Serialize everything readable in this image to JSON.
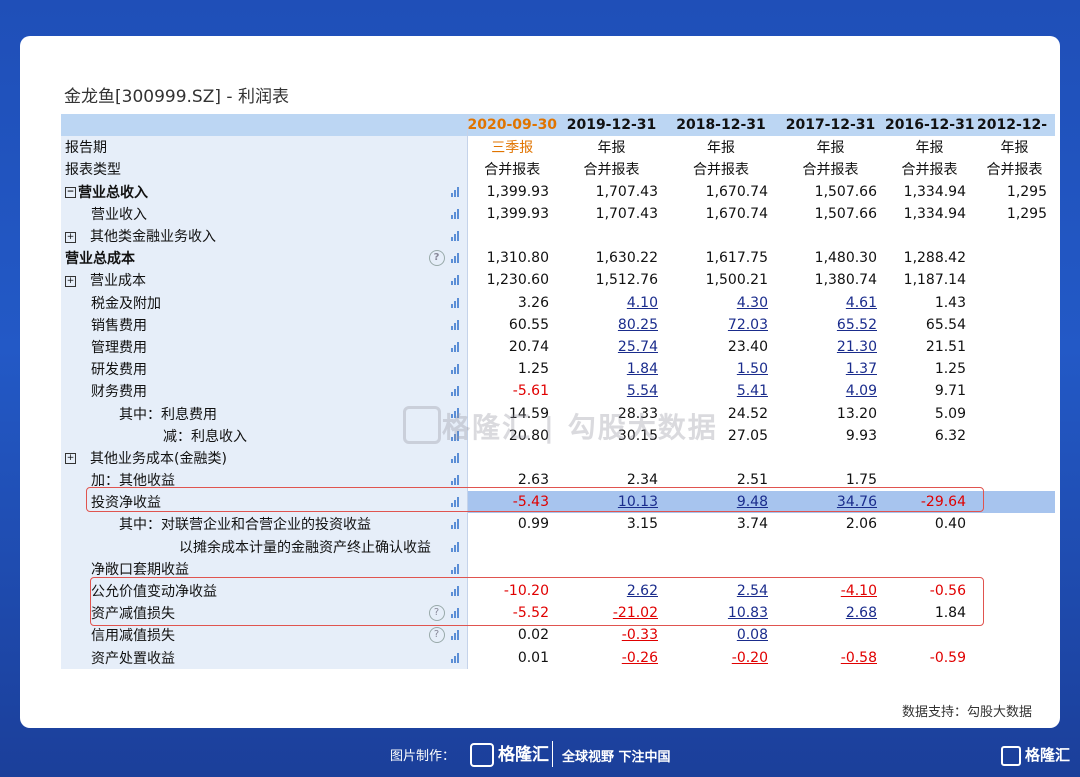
{
  "title": "金龙鱼[300999.SZ] - 利润表",
  "columns": [
    "2020-09-30",
    "2019-12-31",
    "2018-12-31",
    "2017-12-31",
    "2016-12-31",
    "2012-12-"
  ],
  "report_period": {
    "label": "报告期",
    "values": [
      "三季报",
      "年报",
      "年报",
      "年报",
      "年报",
      "年报"
    ]
  },
  "report_type": {
    "label": "报表类型",
    "values": [
      "合并报表",
      "合并报表",
      "合并报表",
      "合并报表",
      "合并报表",
      "合并报表"
    ]
  },
  "rows": [
    {
      "label": "营业总收入",
      "values": [
        "1,399.93",
        "1,707.43",
        "1,670.74",
        "1,507.66",
        "1,334.94",
        "1,295"
      ]
    },
    {
      "label": "营业收入",
      "values": [
        "1,399.93",
        "1,707.43",
        "1,670.74",
        "1,507.66",
        "1,334.94",
        "1,295"
      ]
    },
    {
      "label": "其他类金融业务收入",
      "values": [
        "",
        "",
        "",
        "",
        "",
        ""
      ]
    },
    {
      "label": "营业总成本",
      "values": [
        "1,310.80",
        "1,630.22",
        "1,617.75",
        "1,480.30",
        "1,288.42",
        ""
      ]
    },
    {
      "label": "营业成本",
      "values": [
        "1,230.60",
        "1,512.76",
        "1,500.21",
        "1,380.74",
        "1,187.14",
        ""
      ]
    },
    {
      "label": "税金及附加",
      "values": [
        "3.26",
        "4.10",
        "4.30",
        "4.61",
        "1.43",
        ""
      ]
    },
    {
      "label": "销售费用",
      "values": [
        "60.55",
        "80.25",
        "72.03",
        "65.52",
        "65.54",
        ""
      ]
    },
    {
      "label": "管理费用",
      "values": [
        "20.74",
        "25.74",
        "23.40",
        "21.30",
        "21.51",
        ""
      ]
    },
    {
      "label": "研发费用",
      "values": [
        "1.25",
        "1.84",
        "1.50",
        "1.37",
        "1.25",
        ""
      ]
    },
    {
      "label": "财务费用",
      "values": [
        "-5.61",
        "5.54",
        "5.41",
        "4.09",
        "9.71",
        ""
      ]
    },
    {
      "label": "其中：利息费用",
      "values": [
        "14.59",
        "28.33",
        "24.52",
        "13.20",
        "5.09",
        ""
      ]
    },
    {
      "label": "减：利息收入",
      "values": [
        "20.80",
        "30.15",
        "27.05",
        "9.93",
        "6.32",
        ""
      ]
    },
    {
      "label": "其他业务成本(金融类)",
      "values": [
        "",
        "",
        "",
        "",
        "",
        ""
      ]
    },
    {
      "label": "加：其他收益",
      "values": [
        "2.63",
        "2.34",
        "2.51",
        "1.75",
        "",
        ""
      ]
    },
    {
      "label": "投资净收益",
      "values": [
        "-5.43",
        "10.13",
        "9.48",
        "34.76",
        "-29.64",
        ""
      ]
    },
    {
      "label": "其中：对联营企业和合营企业的投资收益",
      "values": [
        "0.99",
        "3.15",
        "3.74",
        "2.06",
        "0.40",
        ""
      ]
    },
    {
      "label": "以摊余成本计量的金融资产终止确认收益",
      "values": [
        "",
        "",
        "",
        "",
        "",
        ""
      ]
    },
    {
      "label": "净敞口套期收益",
      "values": [
        "",
        "",
        "",
        "",
        "",
        ""
      ]
    },
    {
      "label": "公允价值变动净收益",
      "values": [
        "-10.20",
        "2.62",
        "2.54",
        "-4.10",
        "-0.56",
        ""
      ]
    },
    {
      "label": "资产减值损失",
      "values": [
        "-5.52",
        "-21.02",
        "10.83",
        "2.68",
        "1.84",
        ""
      ]
    },
    {
      "label": "信用减值损失",
      "values": [
        "0.02",
        "-0.33",
        "0.08",
        "",
        "",
        ""
      ]
    },
    {
      "label": "资产处置收益",
      "values": [
        "0.01",
        "-0.26",
        "-0.20",
        "-0.58",
        "-0.59",
        ""
      ]
    }
  ],
  "watermark": "格隆汇 | 勾股大数据",
  "source": "数据支持：勾股大数据",
  "footer": {
    "made_by": "图片制作：",
    "logo": "格隆汇",
    "slogan": "全球视野 下注中国",
    "corner_logo": "格隆汇"
  },
  "colors": {
    "background": "#2359c6",
    "header": "#bcd6f3",
    "label_bg": "#e6eef9",
    "highlight": "#a7c4ee",
    "orange": "#e07400",
    "negative": "#e00000",
    "box": "#e0544f"
  }
}
